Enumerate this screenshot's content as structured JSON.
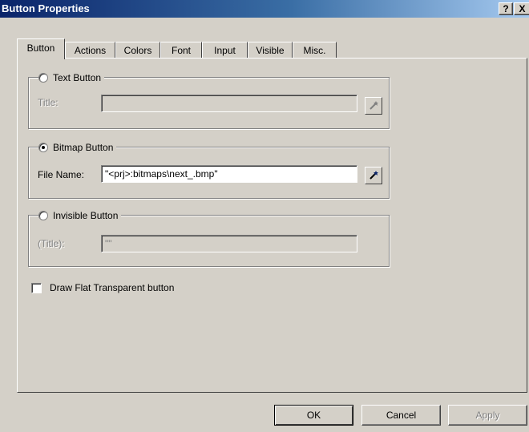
{
  "window": {
    "title": "Button Properties",
    "help_label": "?",
    "close_label": "X"
  },
  "tabs": [
    "Button",
    "Actions",
    "Colors",
    "Font",
    "Input",
    "Visible",
    "Misc."
  ],
  "active_tab": "Button",
  "groups": {
    "text_button": {
      "label": "Text Button",
      "selected": false,
      "field_label": "Title:",
      "field_value": "",
      "enabled": false
    },
    "bitmap_button": {
      "label": "Bitmap Button",
      "selected": true,
      "field_label": "File Name:",
      "field_value": "\"<prj>:bitmaps\\next_.bmp\"",
      "enabled": true
    },
    "invisible_button": {
      "label": "Invisible Button",
      "selected": false,
      "field_label": "(Title):",
      "field_value": "\"\"",
      "enabled": false
    }
  },
  "draw_flat": {
    "label": "Draw Flat Transparent button",
    "checked": false
  },
  "buttons": {
    "ok": "OK",
    "cancel": "Cancel",
    "apply": "Apply"
  },
  "icons": {
    "browse": "wand-icon"
  }
}
